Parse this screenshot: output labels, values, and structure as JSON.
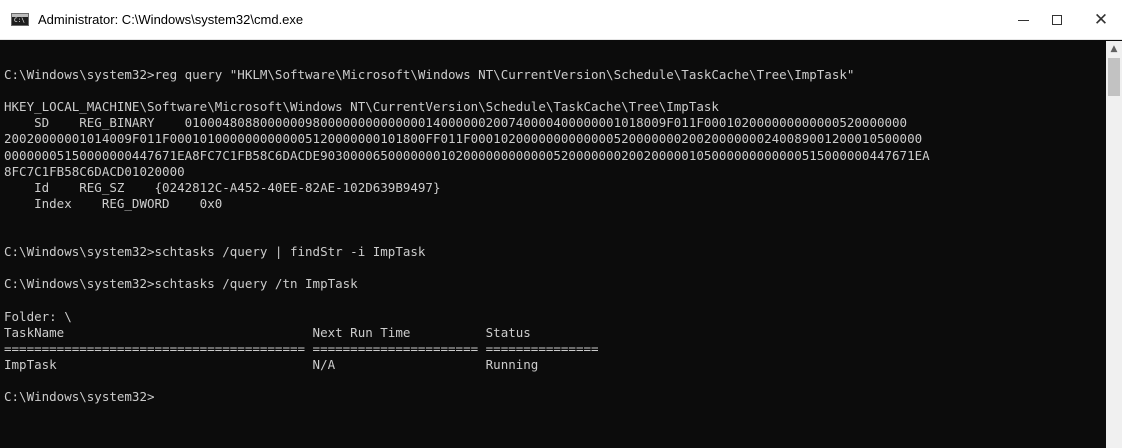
{
  "window": {
    "title": "Administrator: C:\\Windows\\system32\\cmd.exe",
    "controls": {
      "minimize": "—",
      "maximize": "☐",
      "close": "✕"
    }
  },
  "console": {
    "lines": [
      "",
      "C:\\Windows\\system32>reg query \"HKLM\\Software\\Microsoft\\Windows NT\\CurrentVersion\\Schedule\\TaskCache\\Tree\\ImpTask\"",
      "",
      "HKEY_LOCAL_MACHINE\\Software\\Microsoft\\Windows NT\\CurrentVersion\\Schedule\\TaskCache\\Tree\\ImpTask",
      "    SD    REG_BINARY    0100048088000000980000000000000014000000200740000400000001018009F011F000102000000000000520000000",
      "20020000001014009F011F0001010000000000005120000000101800FF011F000102000000000000052000000020020000000240089001200010500000",
      "00000005150000000447671EA8FC7C1FB58C6DACDE9030000650000000102000000000000520000000200200000105000000000000515000000447671EA",
      "8FC7C1FB58C6DACD01020000",
      "    Id    REG_SZ    {0242812C-A452-40EE-82AE-102D639B9497}",
      "    Index    REG_DWORD    0x0",
      "",
      "",
      "C:\\Windows\\system32>schtasks /query | findStr -i ImpTask",
      "",
      "C:\\Windows\\system32>schtasks /query /tn ImpTask",
      "",
      "Folder: \\",
      "TaskName                                 Next Run Time          Status",
      "======================================== ====================== ===============",
      "ImpTask                                  N/A                    Running",
      "",
      "C:\\Windows\\system32>"
    ]
  },
  "scrollbar": {
    "up_arrow": "▲"
  },
  "colors": {
    "console_bg": "#0c0c0c",
    "console_text": "#cccccc",
    "titlebar_bg": "#ffffff"
  },
  "icons": {
    "app": "cmd-console-icon"
  }
}
